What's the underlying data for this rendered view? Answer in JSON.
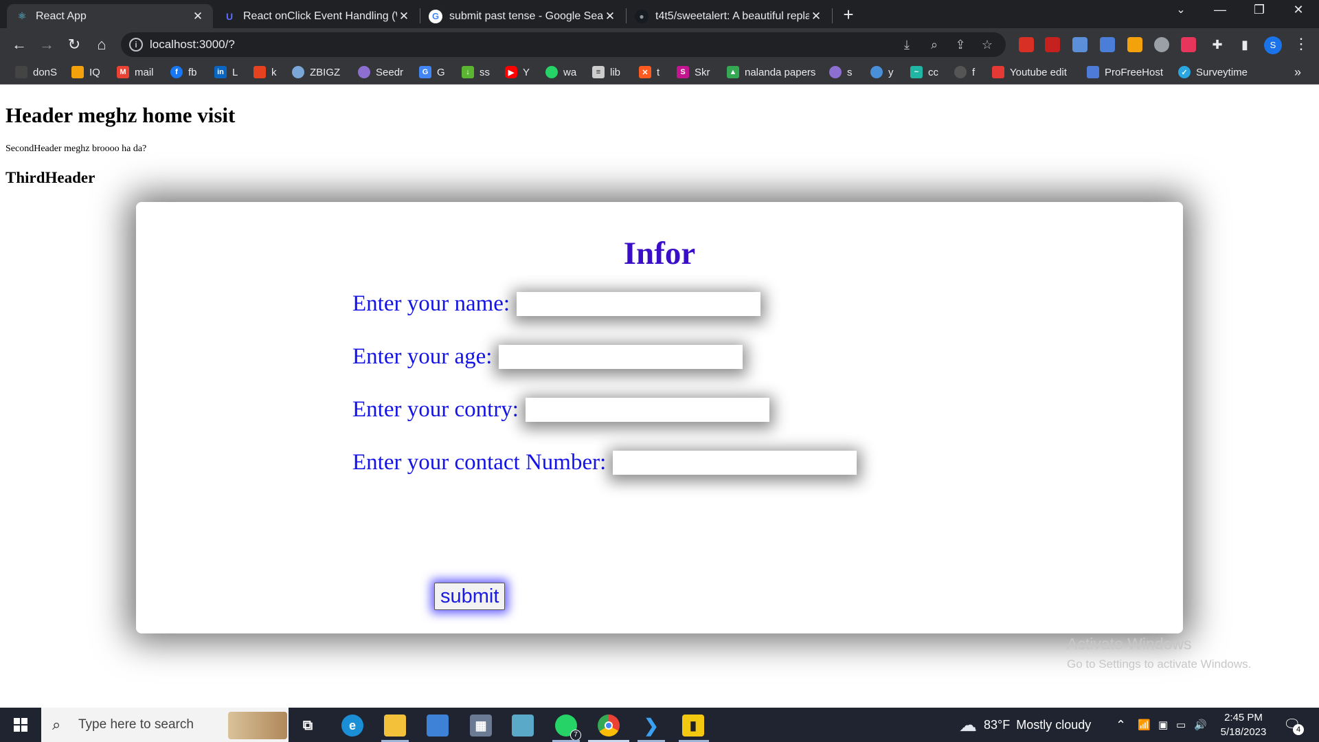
{
  "browser": {
    "tabs": [
      {
        "title": "React App",
        "icon": "react-icon"
      },
      {
        "title": "React onClick Event Handling (W",
        "icon": "u-icon"
      },
      {
        "title": "submit past tense - Google Searc",
        "icon": "google-icon"
      },
      {
        "title": "t4t5/sweetalert: A beautiful repla",
        "icon": "github-icon"
      }
    ],
    "url": "localhost:3000/?"
  },
  "bookmarks": [
    {
      "label": "donS",
      "color": "#444444"
    },
    {
      "label": "IQ",
      "color": "#f4a20c"
    },
    {
      "label": "mail",
      "color": "#ea4335"
    },
    {
      "label": "fb",
      "color": "#1877f2"
    },
    {
      "label": "L",
      "color": "#0a66c2"
    },
    {
      "label": "k",
      "color": "#e6421f"
    },
    {
      "label": "ZBIGZ",
      "color": "#7aa6d8"
    },
    {
      "label": "Seedr",
      "color": "#8c6fd1"
    },
    {
      "label": "G",
      "color": "#4285f4"
    },
    {
      "label": "ss",
      "color": "#5cb531"
    },
    {
      "label": "Y",
      "color": "#ff0000"
    },
    {
      "label": "wa",
      "color": "#25d366"
    },
    {
      "label": "lib",
      "color": "#cccccc"
    },
    {
      "label": "t",
      "color": "#ff5a1f"
    },
    {
      "label": "Skr",
      "color": "#c3158f"
    },
    {
      "label": "nalanda papers",
      "color": "#34a853"
    },
    {
      "label": "s",
      "color": "#8c6fd1"
    },
    {
      "label": "y",
      "color": "#4a90d9"
    },
    {
      "label": "cc",
      "color": "#21b5a3"
    },
    {
      "label": "f",
      "color": "#555555"
    },
    {
      "label": "Youtube edit",
      "color": "#e53935"
    },
    {
      "label": "ProFreeHost",
      "color": "#4f7bd8"
    },
    {
      "label": "Surveytime",
      "color": "#2aa6e0"
    }
  ],
  "page": {
    "h1": "Header meghz home visit",
    "p": "SecondHeader meghz broooo ha da?",
    "h3": "ThirdHeader"
  },
  "form": {
    "title": "Infor",
    "fields": [
      {
        "label": "Enter your name:",
        "value": ""
      },
      {
        "label": "Enter your age:",
        "value": ""
      },
      {
        "label": "Enter your contry:",
        "value": ""
      },
      {
        "label": "Enter your contact Number:",
        "value": ""
      }
    ],
    "submit_label": "submit"
  },
  "watermark": {
    "line1": "Activate Windows",
    "line2": "Go to Settings to activate Windows."
  },
  "taskbar": {
    "search_placeholder": "Type here to search",
    "weather_temp": "83°F",
    "weather_desc": "Mostly cloudy",
    "time": "2:45 PM",
    "date": "5/18/2023",
    "notification_count": "4",
    "whatsapp_badge": "7"
  },
  "colors": {
    "form_title": "#3a0ec8",
    "form_label": "#1414e6",
    "submit_glow": "#463cff"
  }
}
